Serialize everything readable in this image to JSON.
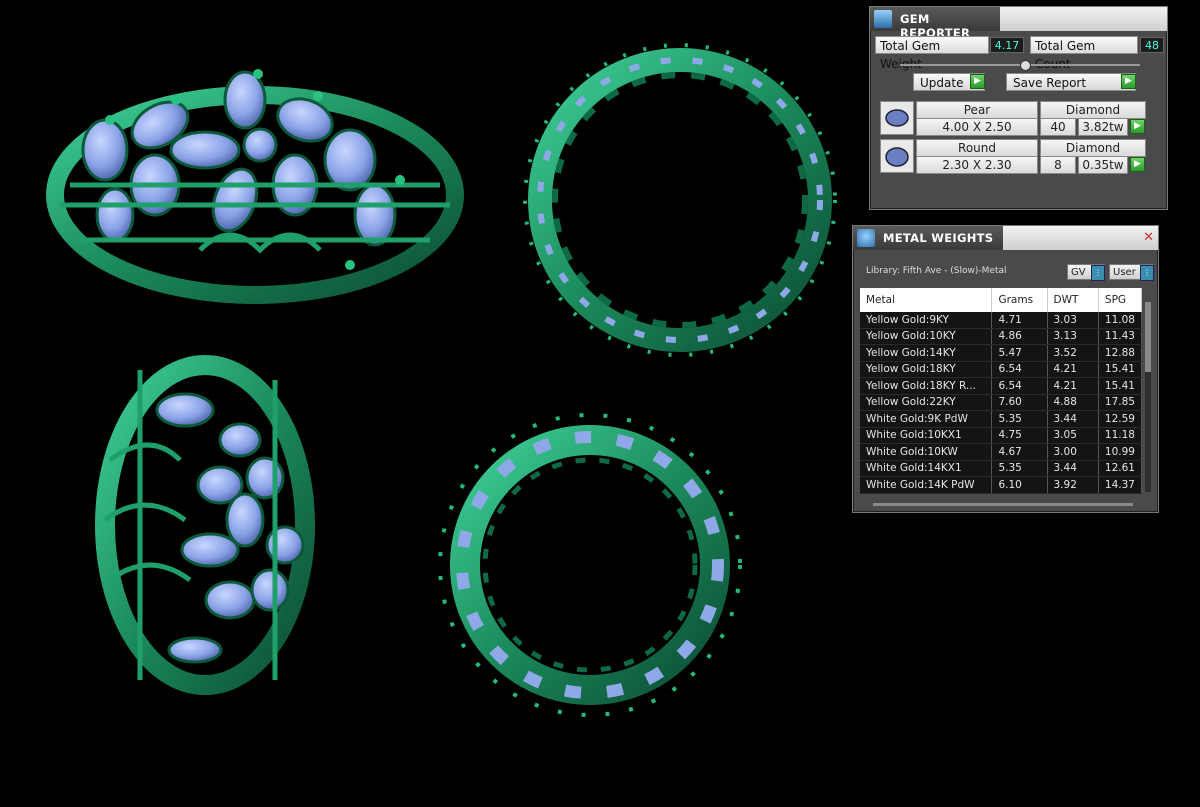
{
  "gem_reporter": {
    "title": "GEM REPORTER",
    "total_weight_label": "Total Gem Weight",
    "total_weight_value": "4.17",
    "total_count_label": "Total Gem Count",
    "total_count_value": "48",
    "update_label": "Update",
    "save_label": "Save Report",
    "rows": [
      {
        "shape": "Pear",
        "material": "Diamond",
        "size": "4.00 X 2.50",
        "count": "40",
        "weight": "3.82tw"
      },
      {
        "shape": "Round",
        "material": "Diamond",
        "size": "2.30 X 2.30",
        "count": "8",
        "weight": "0.35tw"
      }
    ]
  },
  "metal_weights": {
    "title": "METAL WEIGHTS",
    "library": "Library: Fifth Ave - (Slow)-Metal",
    "select1": "GV",
    "select2": "User",
    "columns": [
      "Metal",
      "Grams",
      "DWT",
      "SPG"
    ],
    "rows": [
      [
        "Yellow Gold:9KY",
        "4.71",
        "3.03",
        "11.08"
      ],
      [
        "Yellow Gold:10KY",
        "4.86",
        "3.13",
        "11.43"
      ],
      [
        "Yellow Gold:14KY",
        "5.47",
        "3.52",
        "12.88"
      ],
      [
        "Yellow Gold:18KY",
        "6.54",
        "4.21",
        "15.41"
      ],
      [
        "Yellow Gold:18KY R...",
        "6.54",
        "4.21",
        "15.41"
      ],
      [
        "Yellow Gold:22KY",
        "7.60",
        "4.88",
        "17.85"
      ],
      [
        "White Gold:9K PdW",
        "5.35",
        "3.44",
        "12.59"
      ],
      [
        "White Gold:10KX1",
        "4.75",
        "3.05",
        "11.18"
      ],
      [
        "White Gold:10KW",
        "4.67",
        "3.00",
        "10.99"
      ],
      [
        "White Gold:14KX1",
        "5.35",
        "3.44",
        "12.61"
      ],
      [
        "White Gold:14K PdW",
        "6.10",
        "3.92",
        "14.37"
      ]
    ]
  },
  "colors": {
    "metal": "#1f8f5f",
    "gem": "#8fa8e8",
    "background": "#000000"
  }
}
